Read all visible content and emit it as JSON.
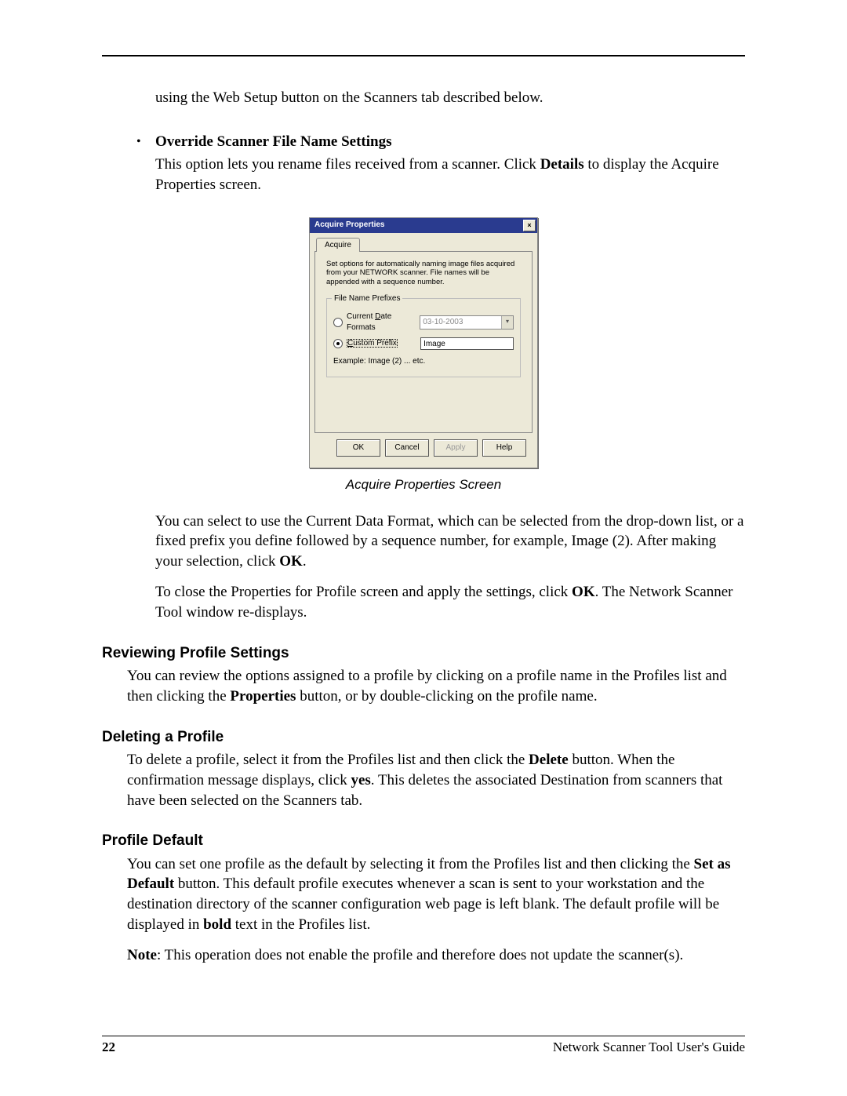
{
  "intro": "using the Web Setup button on the Scanners tab described below.",
  "bullet": {
    "title": "Override Scanner File Name Settings",
    "body_pre": "This option lets you rename files received from a scanner. Click ",
    "body_bold": "Details",
    "body_post": " to display the Acquire Properties screen."
  },
  "dialog": {
    "title": "Acquire Properties",
    "close": "×",
    "tab": "Acquire",
    "desc": "Set options for automatically naming image files acquired from your NETWORK scanner. File names will be appended with a sequence number.",
    "legend": "File Name Prefixes",
    "radio1_pre": "Current ",
    "radio1_ul": "D",
    "radio1_post": "ate Formats",
    "combo_value": "03-10-2003",
    "radio2_ul": "C",
    "radio2_post": "ustom Prefix",
    "textbox_value": "Image",
    "example": "Example: Image (2) ... etc.",
    "buttons": {
      "ok": "OK",
      "cancel": "Cancel",
      "apply": "Apply",
      "help": "Help"
    }
  },
  "caption": "Acquire Properties Screen",
  "after1_a": "You can select to use the Current Data Format, which can be selected from the drop-down list, or a fixed prefix you define followed by a sequence number, for example, Image (2). After making your selection, click ",
  "after1_bold": "OK",
  "after1_b": ".",
  "after2_a": "To close the Properties for Profile screen and apply the settings, click ",
  "after2_bold": "OK",
  "after2_b": ". The Network Scanner Tool window re-displays.",
  "sec1": {
    "title": "Reviewing Profile Settings",
    "body_a": "You can review the options assigned to a profile by clicking on a profile name in the Profiles list and then clicking the ",
    "body_bold": "Properties",
    "body_b": " button, or by double-clicking on the profile name."
  },
  "sec2": {
    "title": "Deleting a Profile",
    "body_a": "To delete a profile, select it from the Profiles list and then click the ",
    "body_bold1": "Delete",
    "body_b": " button.  When the confirmation message displays, click ",
    "body_bold2": "yes",
    "body_c": ". This deletes the associated Destination from scanners that have been selected on the Scanners tab."
  },
  "sec3": {
    "title": "Profile Default",
    "p1_a": "You can set one profile as the default by selecting it from the Profiles list and then clicking the ",
    "p1_bold1": "Set as Default",
    "p1_b": " button. This default profile executes whenever a scan is sent to your workstation and the destination directory of the scanner configuration web page is left blank. The default profile will be displayed in ",
    "p1_bold2": "bold",
    "p1_c": " text in the Profiles list.",
    "p2_bold": "Note",
    "p2_body": ": This operation does not enable the profile and therefore does not update the scanner(s)."
  },
  "footer": {
    "page": "22",
    "doc": "Network Scanner Tool User's Guide"
  }
}
